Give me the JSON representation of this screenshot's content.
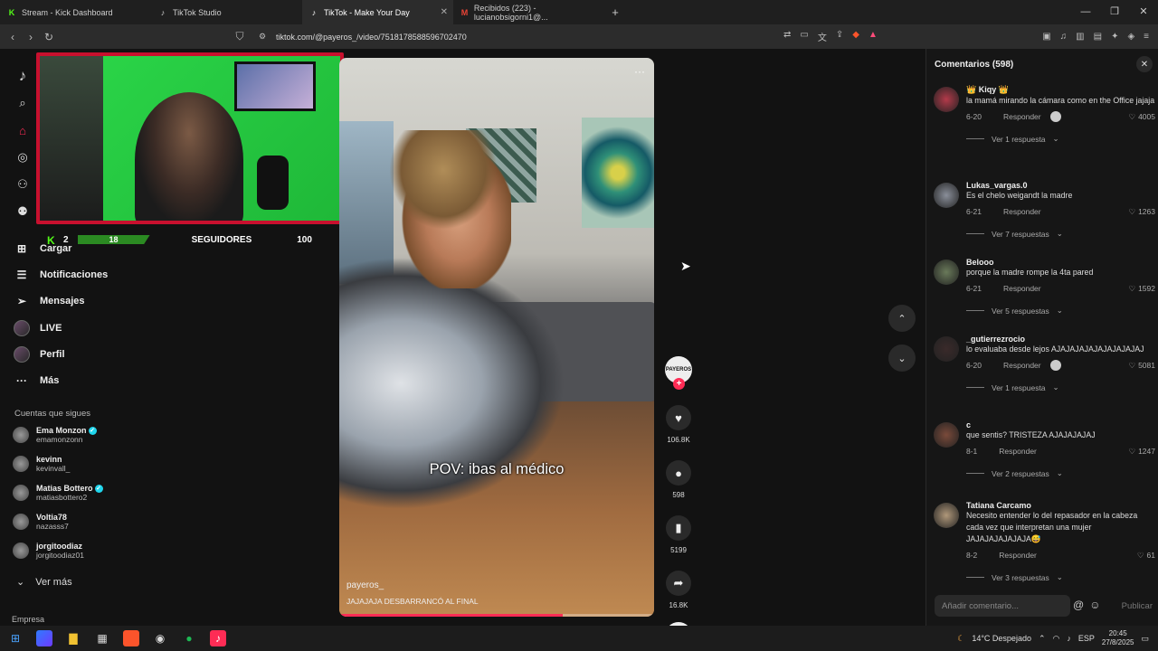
{
  "browser": {
    "tabs": [
      {
        "title": "Stream - Kick Dashboard",
        "icon": "kick-icon"
      },
      {
        "title": "TikTok Studio",
        "icon": "tiktok-icon"
      },
      {
        "title": "TikTok - Make Your Day",
        "icon": "tiktok-icon",
        "active": true
      },
      {
        "title": "Recibidos (223) - lucianobsigorni1@...",
        "icon": "gmail-icon"
      }
    ],
    "url": "tiktok.com/@payeros_/video/7518178588596702470"
  },
  "stream_overlay": {
    "kick_level": "2",
    "progress_value": "18",
    "followers_label": "SEGUIDORES",
    "followers_value": "100"
  },
  "sidebar": {
    "items": [
      {
        "label": "Cargar",
        "icon": "upload-icon"
      },
      {
        "label": "Notificaciones",
        "icon": "inbox-icon"
      },
      {
        "label": "Mensajes",
        "icon": "send-icon"
      },
      {
        "label": "LIVE",
        "icon": "live-icon"
      },
      {
        "label": "Perfil",
        "icon": "avatar"
      },
      {
        "label": "Más",
        "icon": "more-icon"
      }
    ],
    "following_title": "Cuentas que sigues",
    "following": [
      {
        "name": "Ema Monzon",
        "user": "emamonzonn",
        "verified": true
      },
      {
        "name": "kevinn",
        "user": "kevinvall_",
        "verified": false
      },
      {
        "name": "Matias Bottero",
        "user": "matiasbottero2",
        "verified": true
      },
      {
        "name": "Voltia78",
        "user": "nazasss7",
        "verified": false
      },
      {
        "name": "jorgitoodiaz",
        "user": "jorgitoodiaz01",
        "verified": false
      }
    ],
    "see_more": "Ver más",
    "company": "Empresa"
  },
  "video": {
    "caption": "POV: ibas al médico",
    "author": "payeros_",
    "description": "JAJAJAJA DESBARRANCÓ AL FINAL",
    "progress": 0.71,
    "avatar_text": "PAYEROS"
  },
  "actions": {
    "likes": "106.8K",
    "comments": "598",
    "saves": "5199",
    "shares": "16.8K"
  },
  "comments_panel": {
    "title": "Comentarios (598)",
    "reply_label": "Responder",
    "comments": [
      {
        "name": "👑 Kiqy 👑",
        "text": "la mamá mirando la cámara como en the Office jajaja",
        "date": "6-20",
        "likes": "4005",
        "replies": "Ver 1 respuesta",
        "creator_liked": true
      },
      {
        "name": "Lukas_vargas.0",
        "text": "Es el chelo weigandt la madre",
        "date": "6-21",
        "likes": "1263",
        "replies": "Ver 7 respuestas",
        "creator_liked": false
      },
      {
        "name": "Belooo",
        "text": "porque la madre rompe la 4ta pared",
        "date": "6-21",
        "likes": "1592",
        "replies": "Ver 5 respuestas",
        "creator_liked": false
      },
      {
        "name": "_gutierrezrocio",
        "text": "lo evaluaba desde lejos AJAJAJAJAJAJAJAJAJAJ",
        "date": "6-20",
        "likes": "5081",
        "replies": "Ver 1 respuesta",
        "creator_liked": true
      },
      {
        "name": "c",
        "text": "que sentis? TRISTEZA AJAJAJAJAJ",
        "date": "8-1",
        "likes": "1247",
        "replies": "Ver 2 respuestas",
        "creator_liked": false
      },
      {
        "name": "Tatiana Carcamo",
        "text": "Necesito entender lo del repasador en la cabeza cada vez que interpretan una mujer JAJAJAJAJAJAJA😅",
        "date": "8-2",
        "likes": "61",
        "replies": "Ver 3 respuestas",
        "creator_liked": false
      }
    ],
    "add_placeholder": "Añadir comentario...",
    "publish": "Publicar"
  },
  "taskbar": {
    "weather": "14°C  Despejado",
    "lang": "ESP",
    "time": "20:45",
    "date": "27/8/2025"
  }
}
